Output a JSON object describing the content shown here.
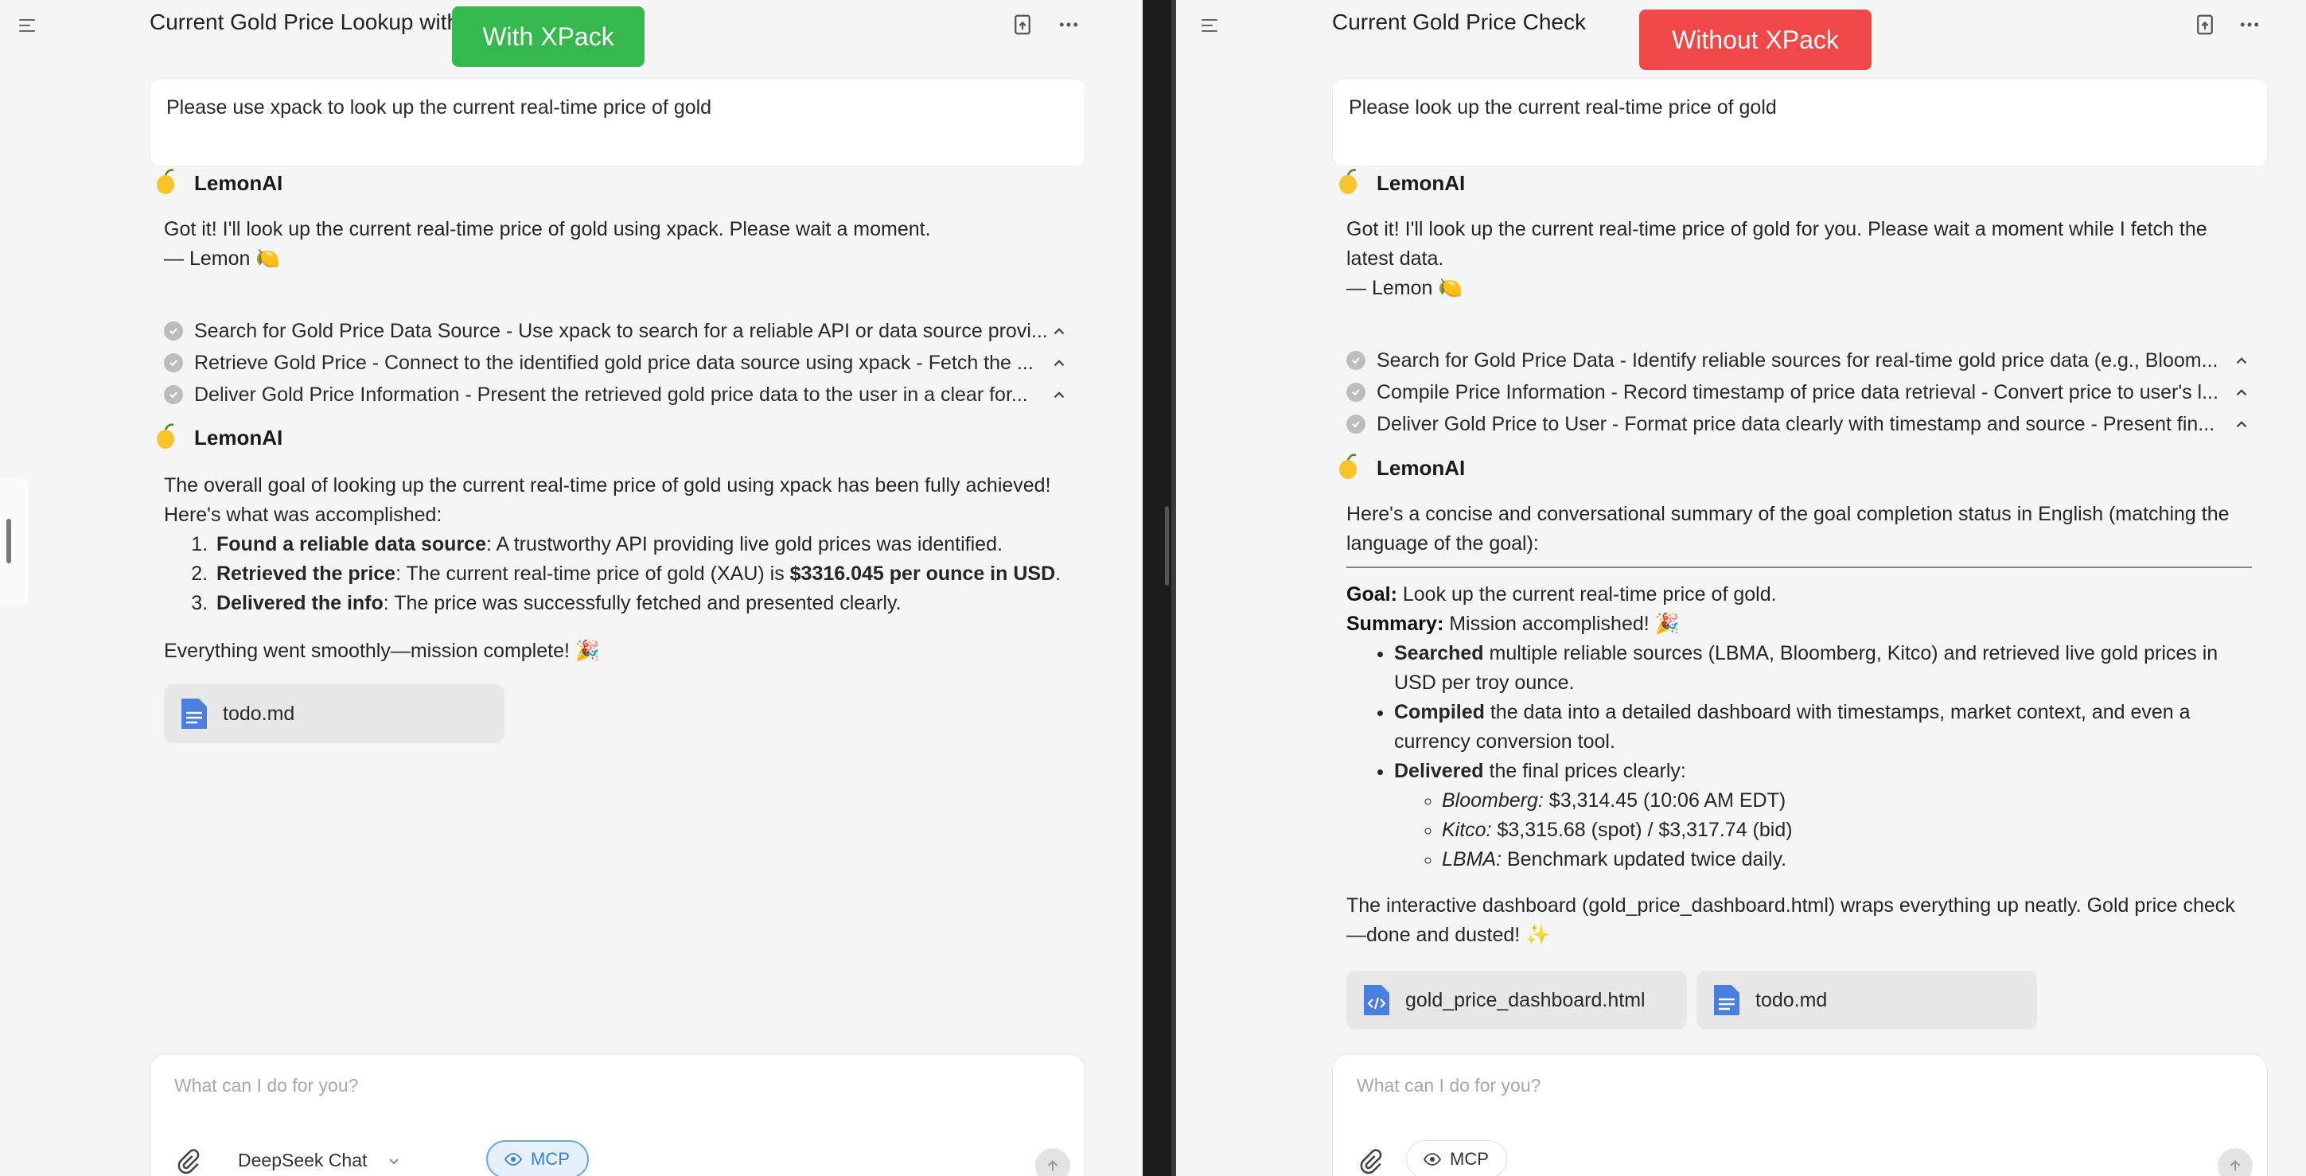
{
  "left": {
    "title": "Current Gold Price Lookup with",
    "badge": "With XPack",
    "user_message": "Please use xpack to look up the current real-time price of gold",
    "assistant_name": "LemonAI",
    "reply_1": "Got it! I'll look up the current real-time price of gold using xpack. Please wait a moment.",
    "reply_1_sign": "— Lemon 🍋",
    "steps": [
      "Search for Gold Price Data Source - Use xpack to search for a reliable API or data source provi...",
      "Retrieve Gold Price - Connect to the identified gold price data source using xpack - Fetch the ...",
      "Deliver Gold Price Information - Present the retrieved gold price data to the user in a clear for..."
    ],
    "summary_intro_1": "The overall goal of looking up the current real-time price of gold using xpack has been fully achieved!",
    "summary_intro_2": "Here's what was accomplished:",
    "items": [
      {
        "bold": "Found a reliable data source",
        "text": ": A trustworthy API providing live gold prices was identified."
      },
      {
        "bold": "Retrieved the price",
        "text": ": The current real-time price of gold (XAU) is ",
        "bold2": "$3316.045 per ounce in USD",
        "tail": "."
      },
      {
        "bold": "Delivered the info",
        "text": ": The price was successfully fetched and presented clearly."
      }
    ],
    "closing": "Everything went smoothly—mission complete! 🎉",
    "file": "todo.md",
    "input_placeholder": "What can I do for you?",
    "model": "DeepSeek Chat",
    "mcp_label": "MCP"
  },
  "right": {
    "title": "Current Gold Price Check",
    "badge": "Without XPack",
    "user_message": "Please look up the current real-time price of gold",
    "assistant_name": "LemonAI",
    "reply_1a": "Got it! I'll look up the current real-time price of gold for you. Please wait a moment while I fetch the",
    "reply_1b": "latest data.",
    "reply_1_sign": "— Lemon 🍋",
    "steps": [
      "Search for Gold Price Data - Identify reliable sources for real-time gold price data (e.g., Bloom...",
      "Compile Price Information - Record timestamp of price data retrieval - Convert price to user's l...",
      "Deliver Gold Price to User - Format price data clearly with timestamp and source - Present fin..."
    ],
    "summary_line1": "Here's a concise and conversational summary of the goal completion status in English (matching the",
    "summary_line2": "language of the goal):",
    "goal_label": "Goal:",
    "goal_text": " Look up the current real-time price of gold.",
    "summary_label": "Summary:",
    "summary_text": " Mission accomplished! 🎉",
    "b1_bold": "Searched",
    "b1_text": " multiple reliable sources (LBMA, Bloomberg, Kitco) and retrieved live gold prices in",
    "b1_text2": "USD per troy ounce.",
    "b2_bold": "Compiled",
    "b2_text": " the data into a detailed dashboard with timestamps, market context, and even a",
    "b2_text2": "currency conversion tool.",
    "b3_bold": "Delivered",
    "b3_text": " the final prices clearly:",
    "prices": [
      {
        "src": "Bloomberg:",
        "val": " $3,314.45 (10:06 AM EDT)"
      },
      {
        "src": "Kitco:",
        "val": " $3,315.68 (spot) / $3,317.74 (bid)"
      },
      {
        "src": "LBMA:",
        "val": " Benchmark updated twice daily."
      }
    ],
    "closing_1": "The interactive dashboard (gold_price_dashboard.html) wraps everything up neatly. Gold price check",
    "closing_2": "—done and dusted! ✨",
    "files": [
      "gold_price_dashboard.html",
      "todo.md"
    ],
    "input_placeholder": "What can I do for you?",
    "mcp_label": "MCP"
  },
  "colors": {
    "with_badge": "#35b84d",
    "without_badge": "#f04848",
    "mcp_active": "#3a7fd0"
  }
}
